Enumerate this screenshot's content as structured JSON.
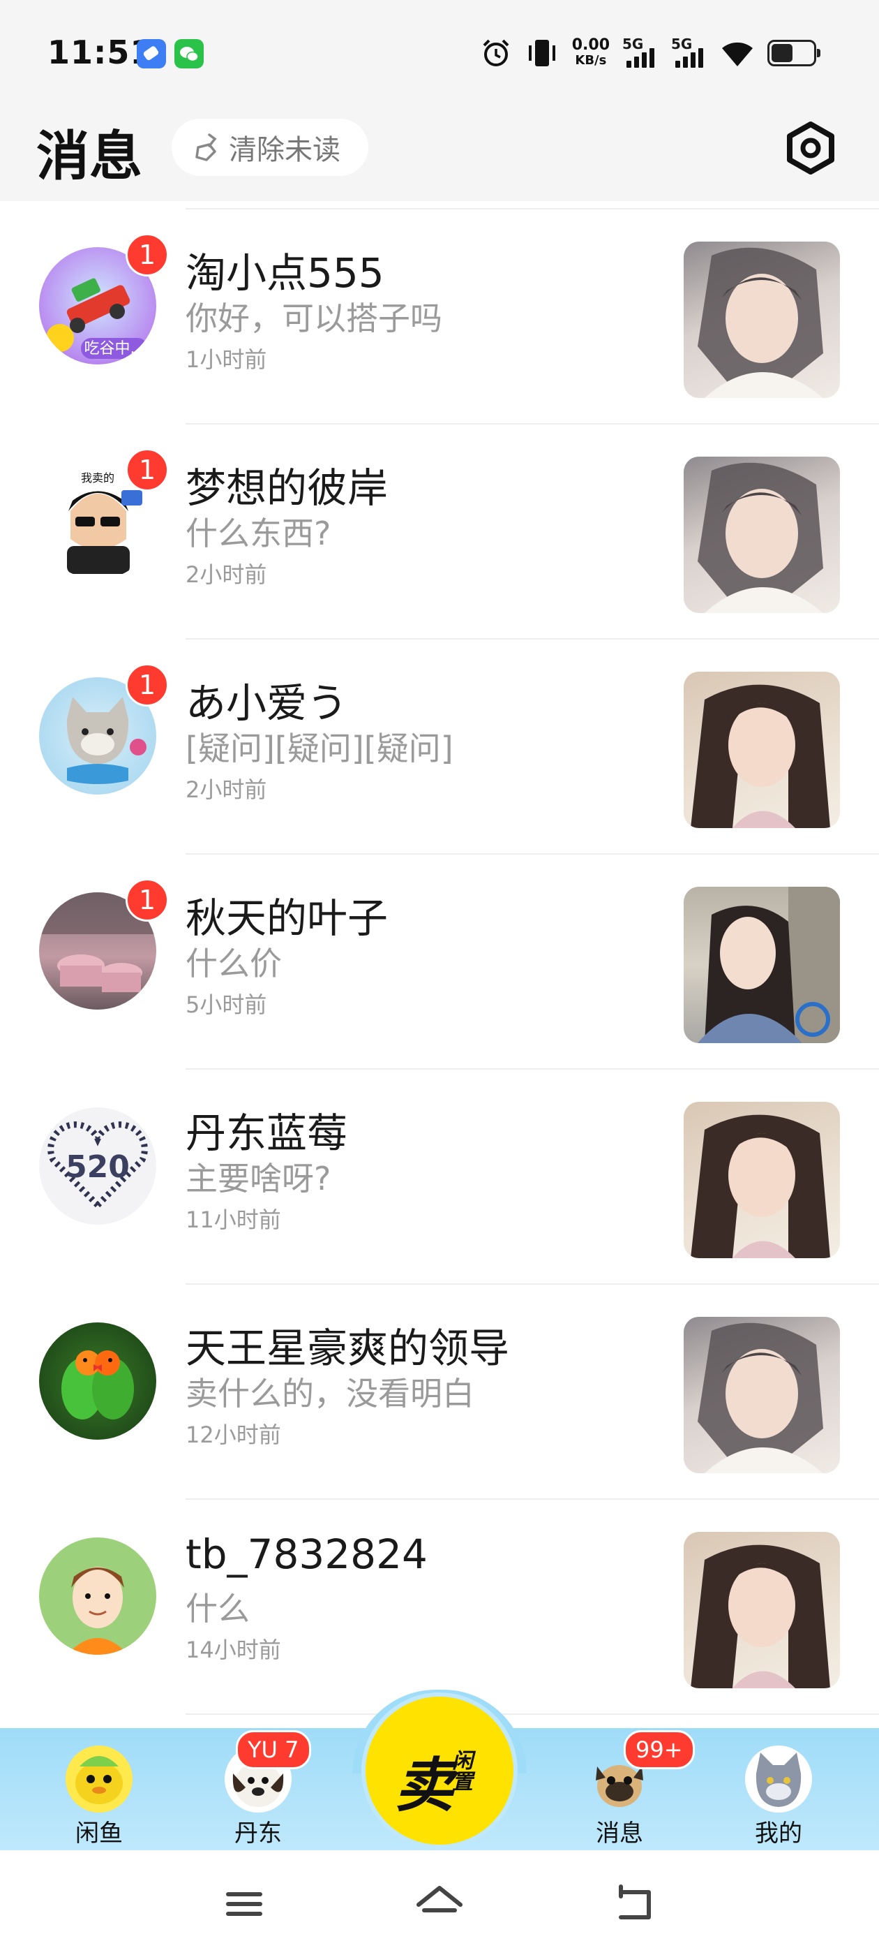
{
  "status_bar": {
    "time": "11:51",
    "net_speed_value": "0.00",
    "net_speed_unit": "KB/s",
    "sim1": "5G",
    "sim2": "5G"
  },
  "header": {
    "title": "消息",
    "clear_unread_label": "清除未读"
  },
  "conversations": [
    {
      "name": "淘小点555",
      "message": "你好，可以搭子吗",
      "time": "1小时前",
      "unread": "1",
      "avatar_caption": "吃谷中..."
    },
    {
      "name": "梦想的彼岸",
      "message": "什么东西?",
      "time": "2小时前",
      "unread": "1",
      "avatar_caption": "我卖的"
    },
    {
      "name": "あ小爱う",
      "message": "[疑问][疑问][疑问]",
      "time": "2小时前",
      "unread": "1"
    },
    {
      "name": "秋天的叶子",
      "message": "什么价",
      "time": "5小时前",
      "unread": "1"
    },
    {
      "name": "丹东蓝莓",
      "message": "主要啥呀?",
      "time": "11小时前",
      "unread": "",
      "avatar_caption": "520"
    },
    {
      "name": "天王星豪爽的领导",
      "message": "卖什么的，没看明白",
      "time": "12小时前",
      "unread": ""
    },
    {
      "name": "tb_7832824",
      "message": "什么",
      "time": "14小时前",
      "unread": ""
    }
  ],
  "tabbar": {
    "tabs": [
      {
        "label": "闲鱼"
      },
      {
        "label": "丹东",
        "badge": "YU 7"
      },
      {
        "label": "消息",
        "badge": "99+"
      },
      {
        "label": "我的"
      }
    ],
    "sell_main": "卖",
    "sell_sub": "闲置"
  },
  "colors": {
    "accent_yellow": "#ffe200",
    "badge_red": "#ff3b30",
    "tabbar_blue": "#9fdcf8"
  },
  "icons": [
    "alarm-icon",
    "vibrate-icon",
    "wifi-icon",
    "battery-icon",
    "broom-icon",
    "settings-icon",
    "menu-icon",
    "home-icon",
    "back-icon"
  ]
}
